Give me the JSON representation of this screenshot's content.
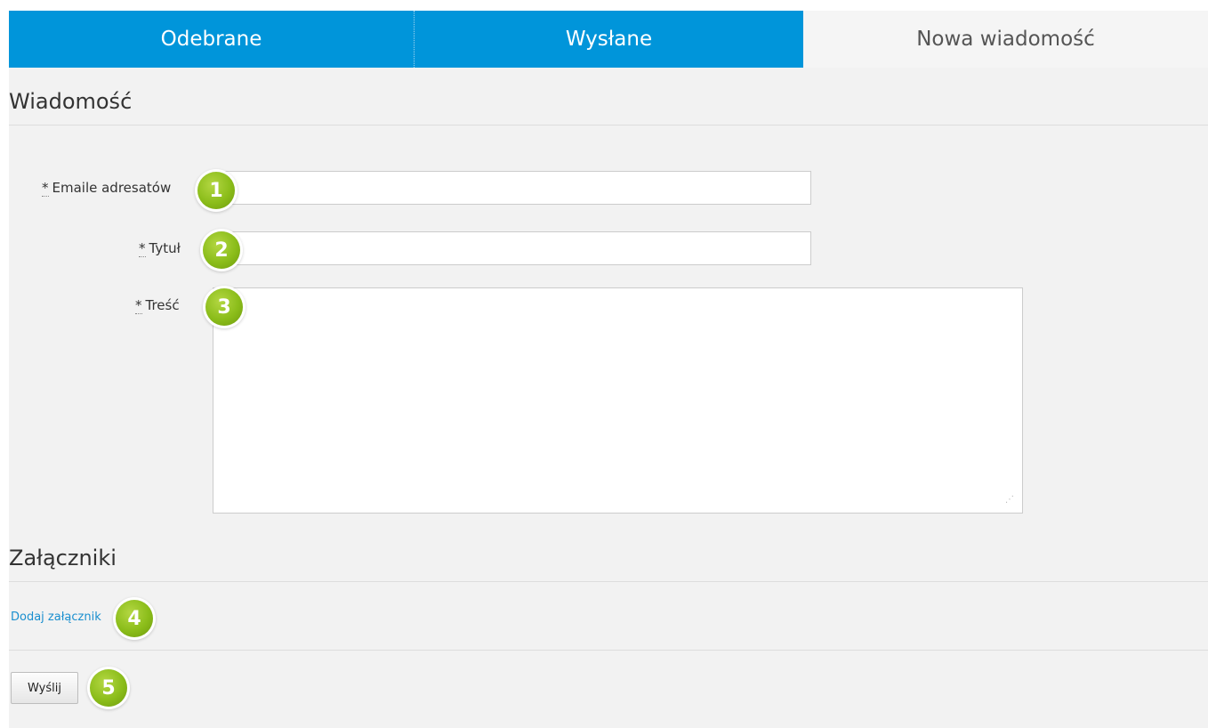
{
  "tabs": [
    {
      "label": "Odebrane",
      "active": false
    },
    {
      "label": "Wysłane",
      "active": false
    },
    {
      "label": "Nowa wiadomość",
      "active": true
    }
  ],
  "colors": {
    "tab_blue": "#0095da",
    "badge_green": "#8bbd1a",
    "link": "#1a8fcf"
  },
  "message_section": {
    "title": "Wiadomość",
    "fields": {
      "emails": {
        "required_mark": "*",
        "label": "Emaile adresatów",
        "value": "",
        "placeholder": ""
      },
      "title": {
        "required_mark": "*",
        "label": "Tytuł",
        "value": "",
        "placeholder": ""
      },
      "body": {
        "required_mark": "*",
        "label": "Treść",
        "value": "",
        "placeholder": ""
      }
    }
  },
  "attachments_section": {
    "title": "Załączniki",
    "add_link": "Dodaj załącznik"
  },
  "actions": {
    "send_label": "Wyślij"
  },
  "badges": [
    "1",
    "2",
    "3",
    "4",
    "5"
  ]
}
